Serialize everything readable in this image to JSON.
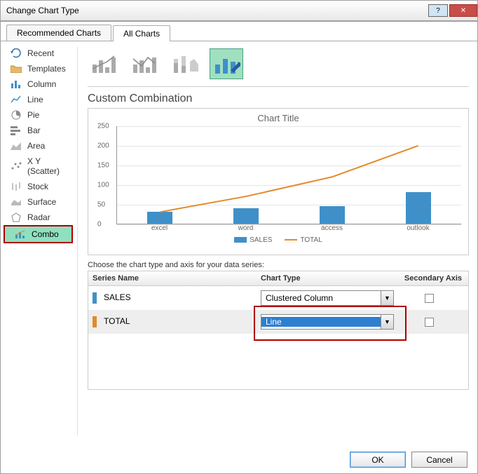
{
  "window": {
    "title": "Change Chart Type"
  },
  "tabs": {
    "recommended": "Recommended Charts",
    "all": "All Charts"
  },
  "categories": [
    {
      "id": "recent",
      "label": "Recent"
    },
    {
      "id": "templates",
      "label": "Templates"
    },
    {
      "id": "column",
      "label": "Column"
    },
    {
      "id": "line",
      "label": "Line"
    },
    {
      "id": "pie",
      "label": "Pie"
    },
    {
      "id": "bar",
      "label": "Bar"
    },
    {
      "id": "area",
      "label": "Area"
    },
    {
      "id": "scatter",
      "label": "X Y (Scatter)"
    },
    {
      "id": "stock",
      "label": "Stock"
    },
    {
      "id": "surface",
      "label": "Surface"
    },
    {
      "id": "radar",
      "label": "Radar"
    },
    {
      "id": "combo",
      "label": "Combo"
    }
  ],
  "section_title": "Custom Combination",
  "chart_data": {
    "type": "combo",
    "title": "Chart Title",
    "categories": [
      "excel",
      "word",
      "access",
      "outlook"
    ],
    "ylim": [
      0,
      250
    ],
    "yticks": [
      0,
      50,
      100,
      150,
      200,
      250
    ],
    "series": [
      {
        "name": "SALES",
        "type": "bar",
        "color": "#3f90c8",
        "values": [
          30,
          40,
          45,
          80
        ]
      },
      {
        "name": "TOTAL",
        "type": "line",
        "color": "#e38a2a",
        "values": [
          30,
          70,
          120,
          200
        ]
      }
    ]
  },
  "instruction": "Choose the chart type and axis for your data series:",
  "series_headers": {
    "name": "Series Name",
    "type": "Chart Type",
    "axis": "Secondary Axis"
  },
  "series_rows": [
    {
      "name": "SALES",
      "swatch": "#3f90c8",
      "chart_type": "Clustered Column",
      "secondary": false
    },
    {
      "name": "TOTAL",
      "swatch": "#e38a2a",
      "chart_type": "Line",
      "secondary": false
    }
  ],
  "buttons": {
    "ok": "OK",
    "cancel": "Cancel"
  }
}
